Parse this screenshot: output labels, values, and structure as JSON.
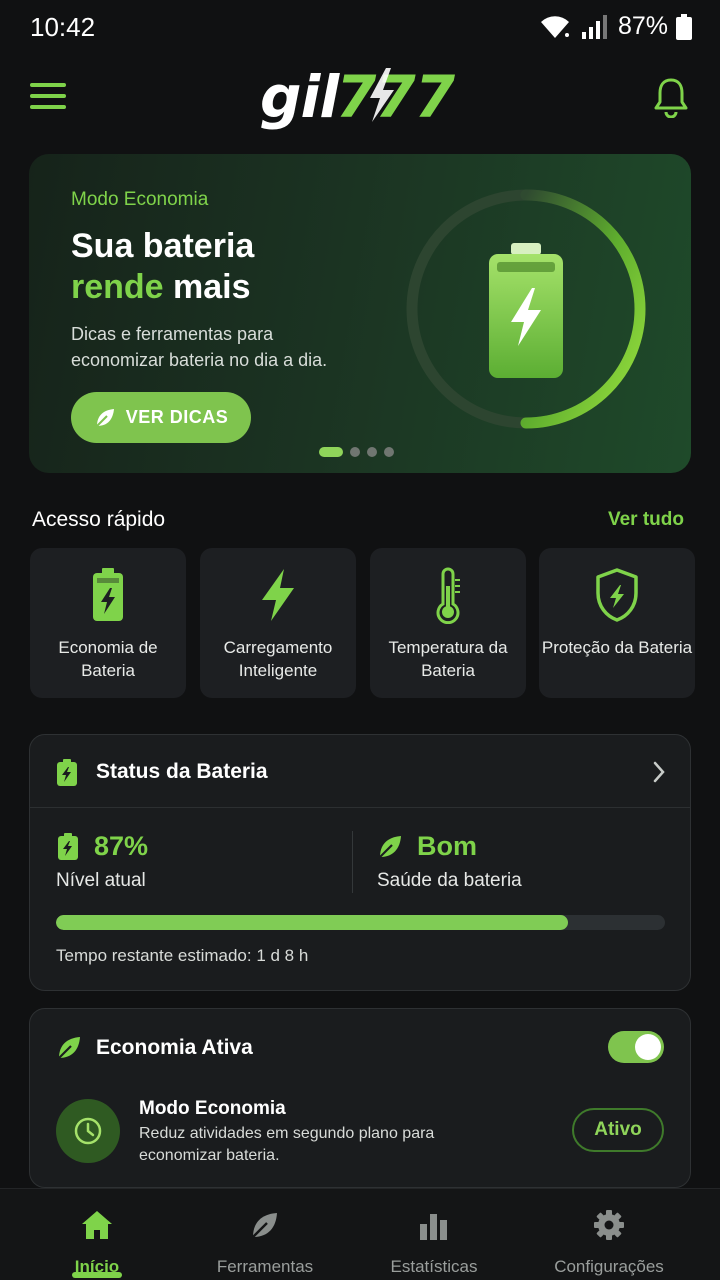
{
  "status_bar": {
    "time": "10:42",
    "battery_percent": "87%"
  },
  "app_bar": {
    "logo_text": "gil777",
    "icons": [
      "menu-icon",
      "notification-bell-icon"
    ]
  },
  "hero": {
    "kicker": "Modo Economia",
    "title_line1": "Sua bateria",
    "title_accent": "rende",
    "title_rest": " mais",
    "description": "Dicas e ferramentas para economizar bateria no dia a dia.",
    "button_label": "VER DICAS",
    "carousel_pages": 4,
    "carousel_active": 0
  },
  "quick_access": {
    "title": "Acesso rápido",
    "see_all": "Ver tudo",
    "items": [
      {
        "label": "Economia de Bateria",
        "icon": "battery-charging-icon"
      },
      {
        "label": "Carregamento Inteligente",
        "icon": "lightning-bolt-icon"
      },
      {
        "label": "Temperatura da Bateria",
        "icon": "thermometer-icon"
      },
      {
        "label": "Proteção da Bateria",
        "icon": "shield-bolt-icon"
      }
    ]
  },
  "battery_status": {
    "title": "Status da Bateria",
    "level_value": "87%",
    "level_label": "Nível atual",
    "level_fraction": 0.84,
    "health_value": "Bom",
    "health_label": "Saúde da bateria",
    "remaining": "Tempo restante estimado: 1 d 8 h"
  },
  "economy": {
    "title": "Economia Ativa",
    "toggle_on": true,
    "mode_title": "Modo Economia",
    "mode_desc": "Reduz atividades em segundo plano para economizar bateria.",
    "badge": "Ativo"
  },
  "bottom_nav": {
    "items": [
      {
        "label": "Início",
        "icon": "home-icon",
        "active": true
      },
      {
        "label": "Ferramentas",
        "icon": "leaf-icon",
        "active": false
      },
      {
        "label": "Estatísticas",
        "icon": "bar-chart-icon",
        "active": false
      },
      {
        "label": "Configurações",
        "icon": "gear-icon",
        "active": false
      }
    ]
  },
  "colors": {
    "accent": "#7fd34a",
    "background": "#101112",
    "card": "#1a1c1e"
  }
}
